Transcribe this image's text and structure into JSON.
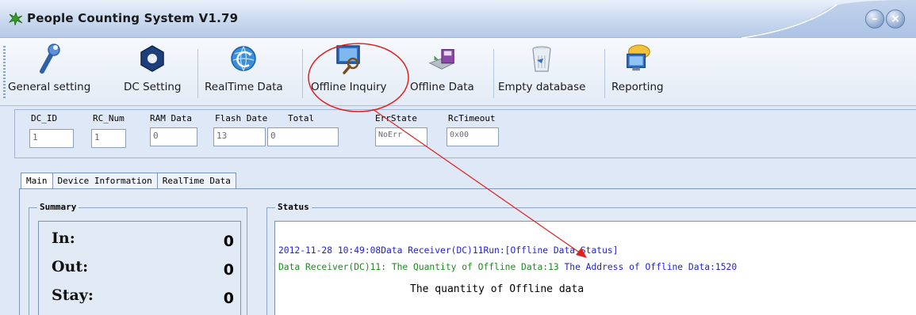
{
  "window": {
    "title": "People Counting System V1.79"
  },
  "toolbar": {
    "buttons": [
      {
        "label": "General setting",
        "icon": "wrench-icon"
      },
      {
        "label": "DC Setting",
        "icon": "nut-icon"
      },
      {
        "label": "RealTime Data",
        "icon": "globe-refresh-icon"
      },
      {
        "label": "Offline Inquiry",
        "icon": "monitor-search-icon"
      },
      {
        "label": "Offline Data",
        "icon": "disk-save-icon"
      },
      {
        "label": "Empty database",
        "icon": "trash-bin-icon"
      },
      {
        "label": "Reporting",
        "icon": "monitor-speech-icon"
      }
    ]
  },
  "fields": [
    {
      "label": "DC_ID",
      "value": "1"
    },
    {
      "label": "RC_Num",
      "value": "1"
    },
    {
      "label": "RAM Data",
      "value": "0"
    },
    {
      "label": "Flash Date",
      "value": "13"
    },
    {
      "label": "Total",
      "value": "0"
    },
    {
      "label": "ErrState",
      "value": "NoErr"
    },
    {
      "label": "RcTimeout",
      "value": "0x00"
    }
  ],
  "tabs": [
    {
      "label": "Main",
      "active": true
    },
    {
      "label": "Device Information",
      "active": false
    },
    {
      "label": "RealTime Data",
      "active": false
    }
  ],
  "summary": {
    "title": "Summary",
    "rows": [
      {
        "label": "In:",
        "value": "0"
      },
      {
        "label": "Out:",
        "value": "0"
      },
      {
        "label": "Stay:",
        "value": "0"
      }
    ]
  },
  "status": {
    "title": "Status",
    "line1": "2012-11-28 10:49:08Data Receiver(DC)11Run:[Offline Data Status]",
    "line2_green": "Data Receiver(DC)11: The Quantity of Offline Data:13",
    "line2_blue": "  The Address of Offline Data:1520",
    "caption": "The quantity of Offline data"
  },
  "colors": {
    "annotation": "#e02020",
    "log_blue": "#1f1fd0",
    "log_green": "#1d8a1d"
  }
}
